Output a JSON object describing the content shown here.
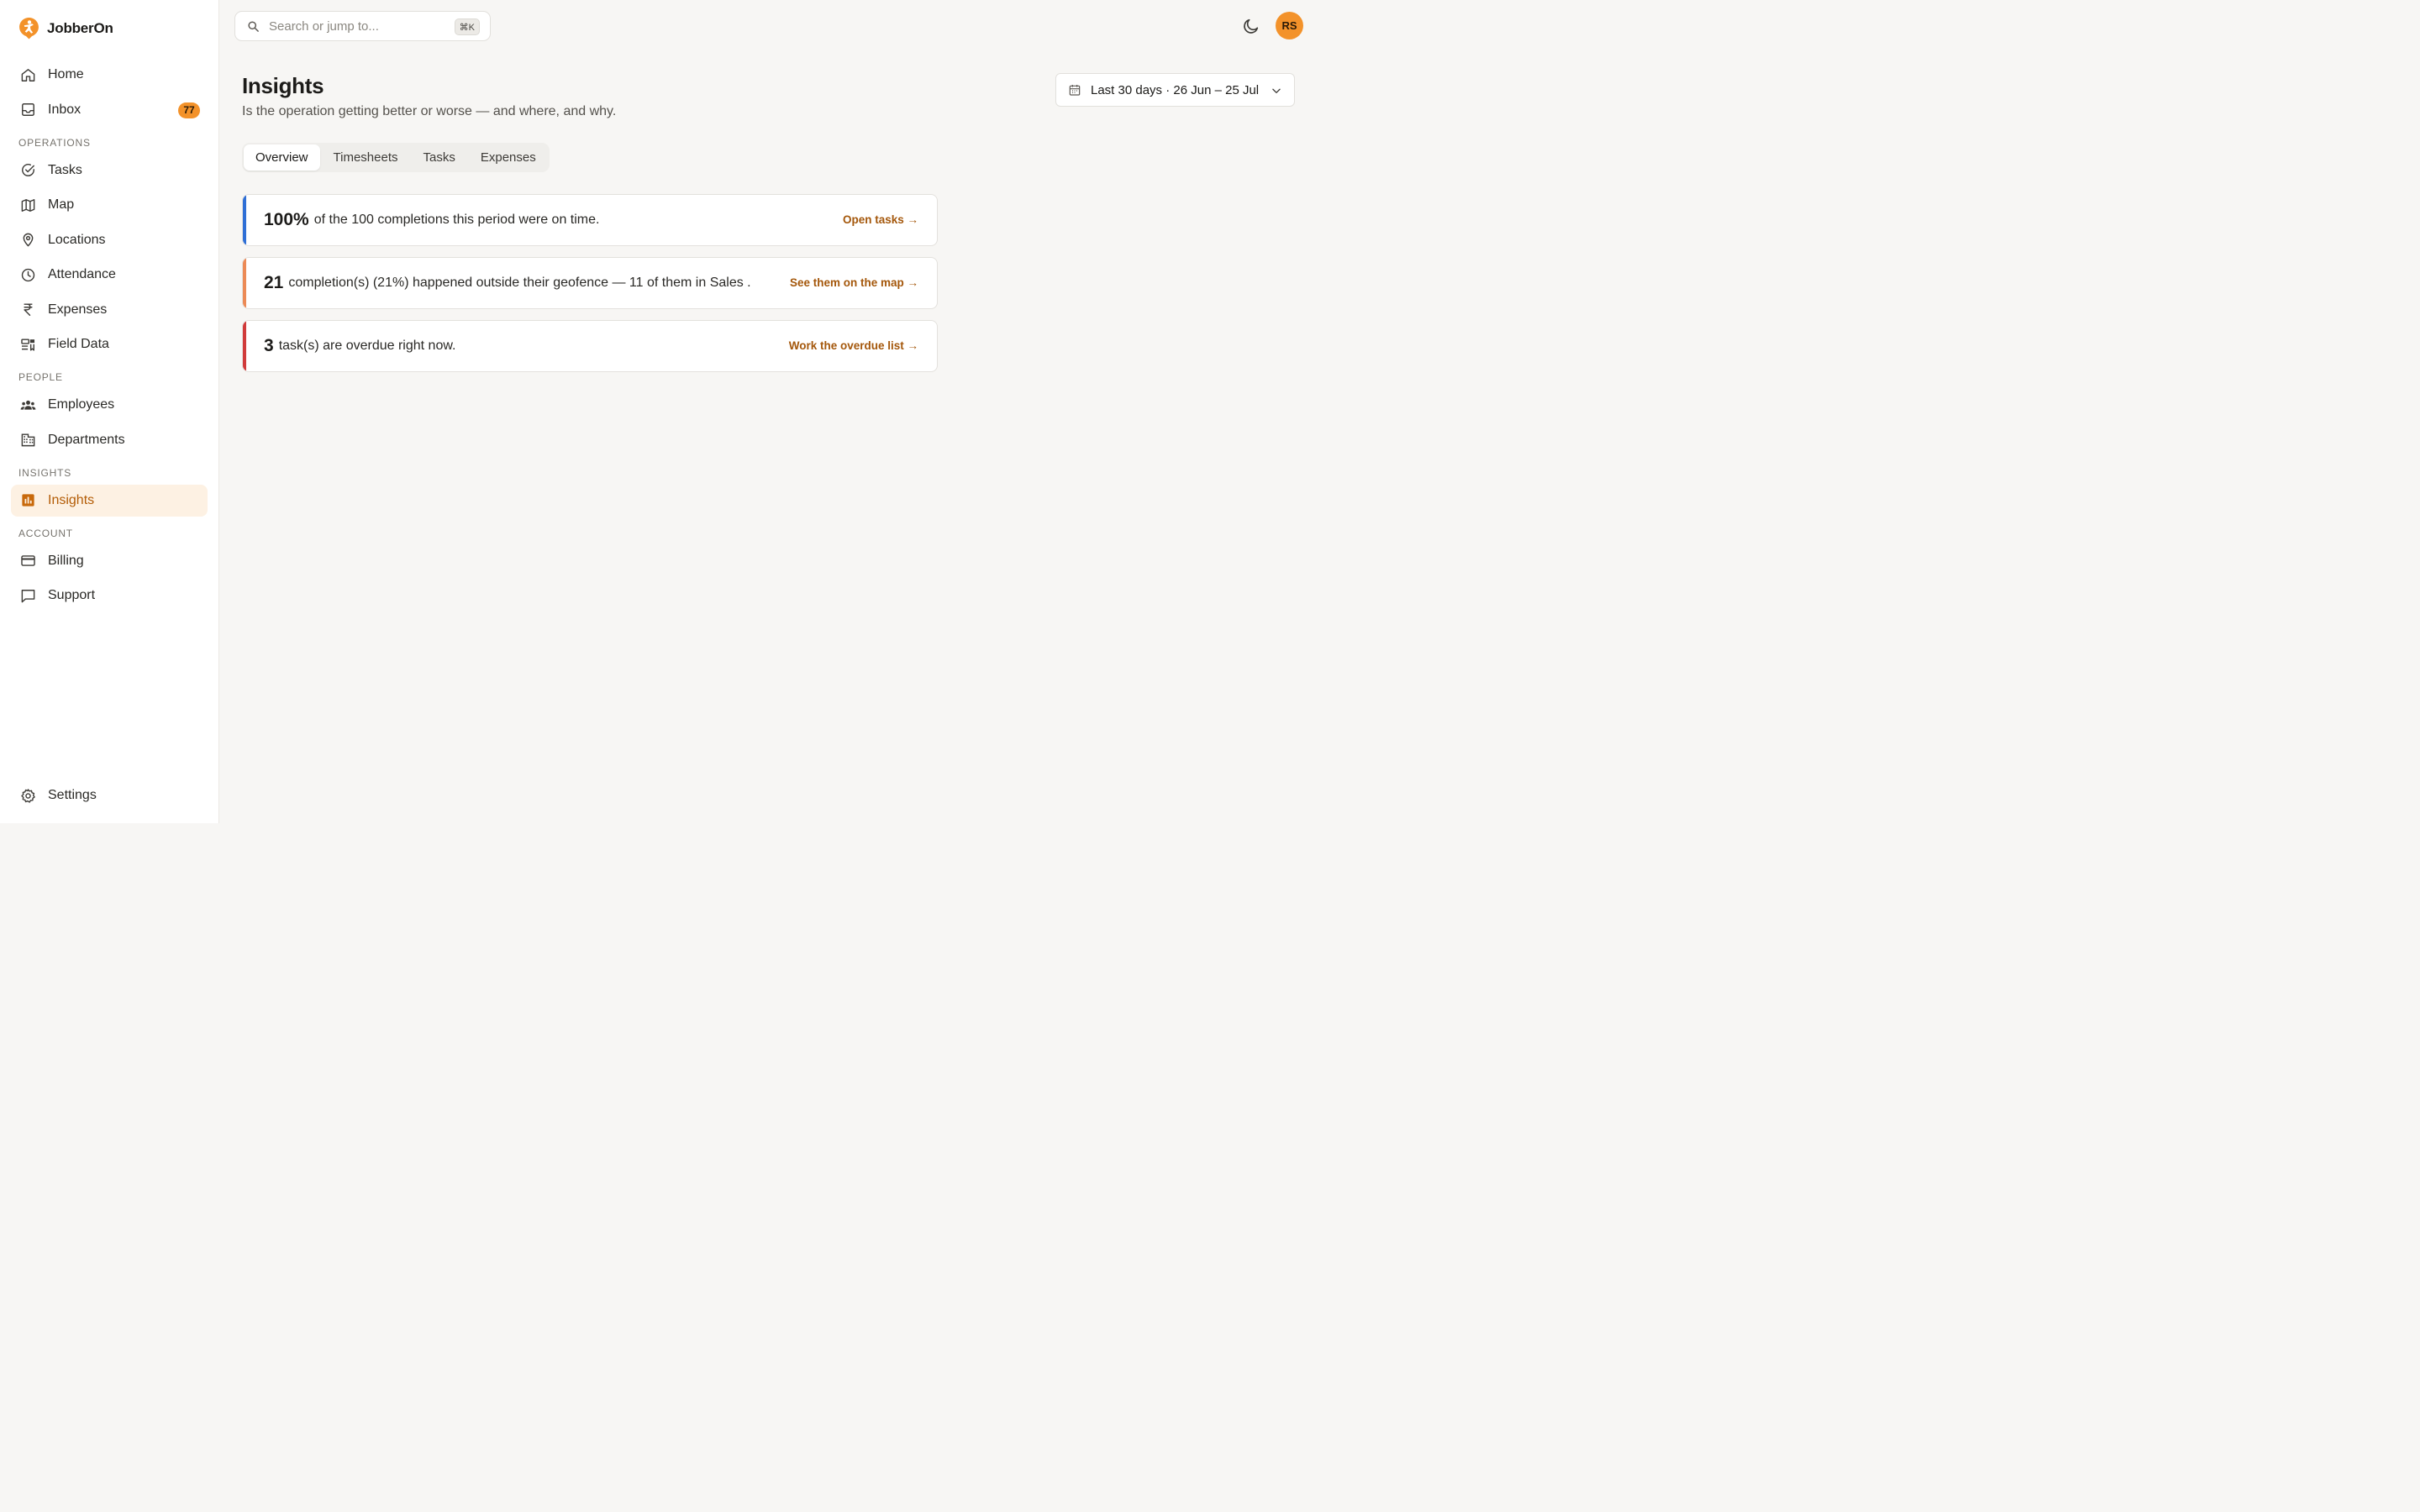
{
  "brand": {
    "name": "JobberOn"
  },
  "sidebar": {
    "top_items": [
      {
        "label": "Home",
        "icon": "home-icon"
      },
      {
        "label": "Inbox",
        "icon": "inbox-icon",
        "badge": "77"
      }
    ],
    "sections": {
      "operations": "OPERATIONS",
      "people": "PEOPLE",
      "insights": "INSIGHTS",
      "account": "ACCOUNT"
    },
    "operations_items": [
      {
        "label": "Tasks",
        "icon": "check-circle-icon"
      },
      {
        "label": "Map",
        "icon": "map-icon"
      },
      {
        "label": "Locations",
        "icon": "map-pin-icon"
      },
      {
        "label": "Attendance",
        "icon": "clock-icon"
      },
      {
        "label": "Expenses",
        "icon": "rupee-icon"
      },
      {
        "label": "Field Data",
        "icon": "form-icon"
      }
    ],
    "people_items": [
      {
        "label": "Employees",
        "icon": "users-icon"
      },
      {
        "label": "Departments",
        "icon": "building-icon"
      }
    ],
    "insights_items": [
      {
        "label": "Insights",
        "icon": "bar-chart-icon",
        "active": true
      }
    ],
    "account_items": [
      {
        "label": "Billing",
        "icon": "credit-card-icon"
      },
      {
        "label": "Support",
        "icon": "message-icon"
      }
    ],
    "settings": {
      "label": "Settings",
      "icon": "gear-icon"
    }
  },
  "search": {
    "placeholder": "Search or jump to...",
    "shortcut": "⌘K"
  },
  "user": {
    "initials": "RS"
  },
  "page": {
    "title": "Insights",
    "subtitle": "Is the operation getting better or worse — and where, and why.",
    "date_range": "Last 30 days · 26 Jun – 25 Jul"
  },
  "tabs": [
    {
      "label": "Overview",
      "active": true
    },
    {
      "label": "Timesheets"
    },
    {
      "label": "Tasks"
    },
    {
      "label": "Expenses"
    }
  ],
  "cards": [
    {
      "big": "100%",
      "text": "of the 100 completions this period were on time.",
      "link": "Open tasks →",
      "accent": "#2f6fd6"
    },
    {
      "big": "21",
      "text": "completion(s) (21%) happened outside their geofence — 11 of them in Sales .",
      "link": "See them on the map →",
      "accent": "#ec8a56"
    },
    {
      "big": "3",
      "text": "task(s) are overdue right now.",
      "link": "Work the overdue list →",
      "accent": "#d13b3b"
    }
  ],
  "colors": {
    "accent": "#f3922a",
    "active_bg": "#fdf1e3",
    "link": "#a4570b"
  }
}
